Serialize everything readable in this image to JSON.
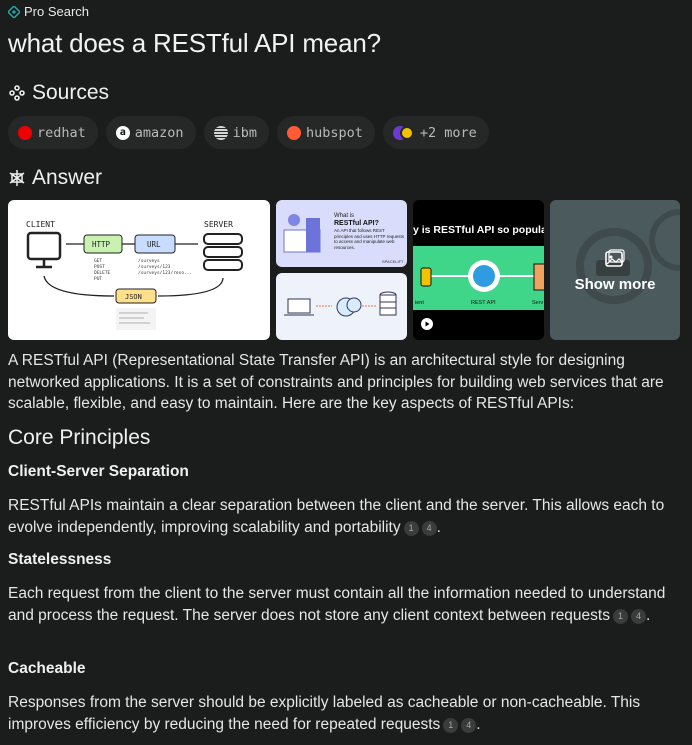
{
  "header": {
    "pro_search_label": "Pro Search",
    "query": "what does a RESTful API mean?"
  },
  "sources": {
    "title": "Sources",
    "items": [
      {
        "label": "redhat",
        "icon": "redhat-favicon",
        "color": "#ee0000"
      },
      {
        "label": "amazon",
        "icon": "amazon-favicon",
        "color": "#ffffff"
      },
      {
        "label": "ibm",
        "icon": "ibm-favicon",
        "color": "#cfcfcf"
      },
      {
        "label": "hubspot",
        "icon": "hubspot-favicon",
        "color": "#ff5c35"
      }
    ],
    "more_label": "+2 more"
  },
  "answer": {
    "title": "Answer",
    "images": {
      "image1": {
        "client": "CLIENT",
        "server": "SERVER",
        "http": "HTTP",
        "url": "URL",
        "json": "JSON",
        "methods": [
          "GET",
          "POST",
          "DELETE",
          "PUT"
        ],
        "paths": [
          "/surveys",
          "/surveys/123",
          "/surveys/123/reso..."
        ]
      },
      "image2": {
        "what_is": "What is",
        "title": "RESTful API?",
        "body": "An API that follows REST principles and uses HTTP requests to access and manipulate web resources.",
        "brand": "SPACELIFT"
      },
      "image4": {
        "headline": "y is RESTful API so popular",
        "label_left": "ient",
        "label_mid": "REST API",
        "label_right": "Serv"
      },
      "show_more": "Show more"
    },
    "intro": "A RESTful API (Representational State Transfer API) is an architectural style for designing networked applications. It is a set of constraints and principles for building web services that are scalable, flexible, and easy to maintain. Here are the key aspects of RESTful APIs:",
    "core_heading": "Core Principles",
    "sections": [
      {
        "title": "Client-Server Separation",
        "text": "RESTful APIs maintain a clear separation between the client and the server. This allows each to evolve independently, improving scalability and portability",
        "cites": [
          "1",
          "4"
        ]
      },
      {
        "title": "Statelessness",
        "text": "Each request from the client to the server must contain all the information needed to understand and process the request. The server does not store any client context between requests",
        "cites": [
          "1",
          "4"
        ]
      },
      {
        "title": "Cacheable",
        "text": "Responses from the server should be explicitly labeled as cacheable or non-cacheable. This improves efficiency by reducing the need for repeated requests",
        "cites": [
          "1",
          "4"
        ]
      }
    ]
  }
}
